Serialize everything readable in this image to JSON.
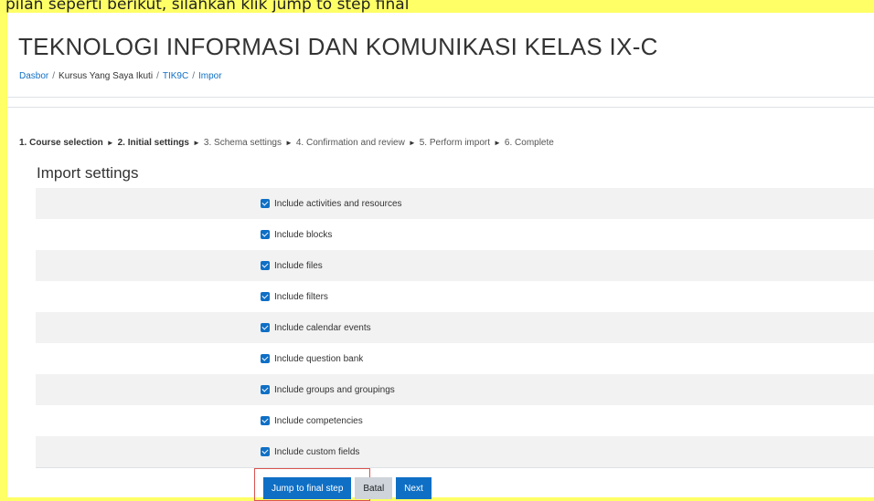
{
  "banner": {
    "text": "pilan seperti berikut, silahkan klik jump to step final"
  },
  "header": {
    "title": "TEKNOLOGI INFORMASI DAN KOMUNIKASI KELAS IX-C",
    "breadcrumb": [
      {
        "label": "Dasbor",
        "link": true
      },
      {
        "label": "Kursus Yang Saya Ikuti",
        "link": false
      },
      {
        "label": "TIK9C",
        "link": true
      },
      {
        "label": "Impor",
        "link": true
      }
    ]
  },
  "steps": [
    {
      "label": "1. Course selection",
      "done": true
    },
    {
      "label": "2. Initial settings",
      "done": true
    },
    {
      "label": "3. Schema settings",
      "done": false
    },
    {
      "label": "4. Confirmation and review",
      "done": false
    },
    {
      "label": "5. Perform import",
      "done": false
    },
    {
      "label": "6. Complete",
      "done": false
    }
  ],
  "step_separator": "►",
  "section_title": "Import settings",
  "settings": [
    {
      "label": "Include activities and resources",
      "checked": true
    },
    {
      "label": "Include blocks",
      "checked": true
    },
    {
      "label": "Include files",
      "checked": true
    },
    {
      "label": "Include filters",
      "checked": true
    },
    {
      "label": "Include calendar events",
      "checked": true
    },
    {
      "label": "Include question bank",
      "checked": true
    },
    {
      "label": "Include groups and groupings",
      "checked": true
    },
    {
      "label": "Include competencies",
      "checked": true
    },
    {
      "label": "Include custom fields",
      "checked": true
    }
  ],
  "buttons": {
    "jump": "Jump to final step",
    "cancel": "Batal",
    "next": "Next"
  },
  "colors": {
    "accent": "#0f6fc5",
    "banner_bg": "#ffff66",
    "highlight": "#d9534f"
  }
}
